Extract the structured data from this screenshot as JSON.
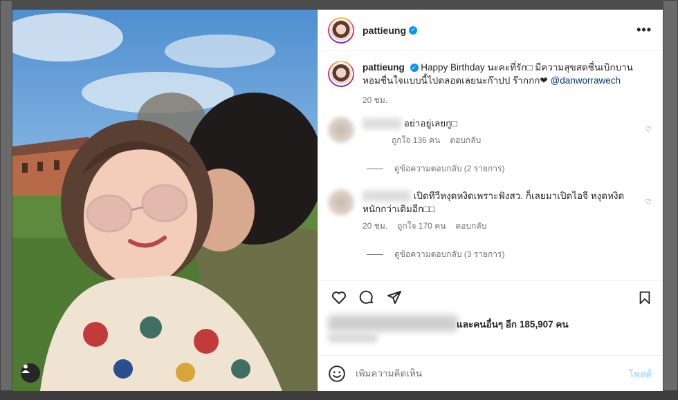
{
  "author": {
    "username": "pattieung",
    "verified_mark": "✓"
  },
  "caption": {
    "text": "Happy Birthday นะคะที่รัก□ มีความสุขสดชื่นเบิกบาน หอมชื่นใจแบบนี้ไปตลอดเลยนะก๊าปป ร๊ากกก❤",
    "mention": "@danworrawech",
    "time": "20 ชม."
  },
  "comments": [
    {
      "text": "อย่าอยู่เลยกู□",
      "likes": "ถูกใจ 136 คน",
      "reply": "ตอบกลับ",
      "view_replies": "ดูข้อความตอบกลับ (2 รายการ)"
    },
    {
      "text": "เปิดทีวีหงุดหงิดเพราะฟังสว. ก็เลยมาเปิดไอจี หงุดหงิดหนักกว่าเดิมอีก□□",
      "time": "20 ชม.",
      "likes": "ถูกใจ 170 คน",
      "reply": "ตอบกลับ",
      "view_replies": "ดูข้อความตอบกลับ (3 รายการ)"
    }
  ],
  "likes_summary": "และคนอื่นๆ อีก 185,907 คน",
  "add_comment": {
    "placeholder": "เพิ่มความคิดเห็น",
    "post_label": "โพสต์"
  },
  "icons": {
    "more": "more-options-icon",
    "like": "heart-icon",
    "comment": "comment-icon",
    "share": "share-icon",
    "save": "bookmark-icon",
    "emoji": "emoji-icon",
    "tag": "user-tag-icon"
  },
  "colors": {
    "link": "#00376b",
    "verified": "#0095f6",
    "post_disabled": "#b2dffc"
  }
}
